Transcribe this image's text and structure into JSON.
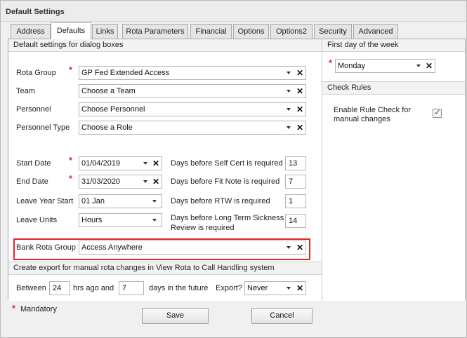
{
  "window": {
    "title": "Default Settings"
  },
  "tabs": [
    {
      "label": "Address"
    },
    {
      "label": "Defaults"
    },
    {
      "label": "Links"
    },
    {
      "label": "Rota Parameters"
    },
    {
      "label": "Financial"
    },
    {
      "label": "Options"
    },
    {
      "label": "Options2"
    },
    {
      "label": "Security"
    },
    {
      "label": "Advanced"
    }
  ],
  "defaults_panel": {
    "header": "Default settings for dialog boxes",
    "rota_group": {
      "label": "Rota Group",
      "value": "GP Fed Extended Access",
      "required": "*"
    },
    "team": {
      "label": "Team",
      "value": "Choose a Team"
    },
    "personnel": {
      "label": "Personnel",
      "value": "Choose Personnel"
    },
    "personnel_type": {
      "label": "Personnel Type",
      "value": "Choose a Role"
    },
    "start_date": {
      "label": "Start Date",
      "value": "01/04/2019",
      "required": "*"
    },
    "end_date": {
      "label": "End Date",
      "value": "31/03/2020",
      "required": "*"
    },
    "leave_year_start": {
      "label": "Leave Year Start",
      "value": "01 Jan"
    },
    "leave_units": {
      "label": "Leave Units",
      "value": "Hours"
    },
    "self_cert": {
      "label": "Days before Self Cert is required",
      "value": "13"
    },
    "fit_note": {
      "label": "Days before Fit Note is required",
      "value": "7"
    },
    "rtw": {
      "label": "Days before RTW is required",
      "value": "1"
    },
    "long_term": {
      "label_line1": "Days before Long Term Sickness",
      "label_line2": "Review is required",
      "value": "14"
    },
    "bank_rota_group": {
      "label": "Bank Rota Group",
      "value": "Access Anywhere"
    }
  },
  "export_panel": {
    "header": "Create export for manual rota changes in View Rota to Call Handling system",
    "between_label": "Between",
    "hours_value": "24",
    "hrs_ago_label": "hrs ago and",
    "days_value": "7",
    "days_future_label": "days in the future",
    "export_label": "Export?",
    "export_value": "Never"
  },
  "first_day_panel": {
    "header": "First day of the week",
    "required": "*",
    "value": "Monday"
  },
  "check_rules_panel": {
    "header": "Check Rules",
    "label_line1": "Enable Rule Check for",
    "label_line2": "manual changes",
    "checked": true
  },
  "footer": {
    "mandatory_mark": "*",
    "mandatory_label": "Mandatory",
    "save_label": "Save",
    "cancel_label": "Cancel"
  },
  "colors": {
    "required": "#d9302c",
    "highlight_border": "#e0242d"
  },
  "icons": {
    "dropdown": "chevron-down-icon",
    "clear": "close-icon",
    "check": "checkmark-icon"
  }
}
